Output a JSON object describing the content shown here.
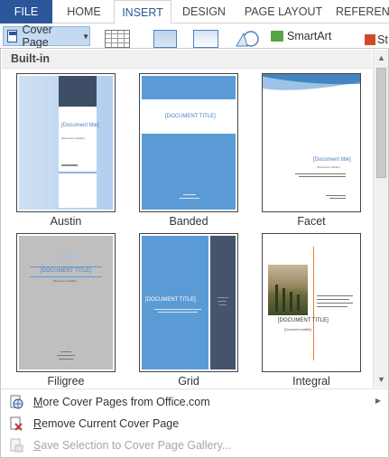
{
  "ribbon": {
    "tabs": [
      {
        "label": "FILE"
      },
      {
        "label": "HOME"
      },
      {
        "label": "INSERT"
      },
      {
        "label": "DESIGN"
      },
      {
        "label": "PAGE LAYOUT"
      },
      {
        "label": "REFERENC"
      }
    ],
    "active_tab": "INSERT",
    "cover_page_button": "Cover Page",
    "smartart_label": "SmartArt",
    "store_label": "St"
  },
  "gallery": {
    "section_label": "Built-in",
    "templates": [
      {
        "name": "Austin",
        "title": "[Document title]",
        "subtitle": "[Document subtitle]"
      },
      {
        "name": "Banded",
        "title": "[DOCUMENT TITLE]"
      },
      {
        "name": "Facet",
        "title": "[Document title]",
        "subtitle": "[Document subtitle]"
      },
      {
        "name": "Filigree",
        "title": "[DOCUMENT TITLE]",
        "subtitle": "[Document subtitle]"
      },
      {
        "name": "Grid",
        "title": "[DOCUMENT TITLE]"
      },
      {
        "name": "Integral",
        "title": "[DOCUMENT TITLE]",
        "subtitle": "[Document subtitle]"
      }
    ]
  },
  "menu": {
    "more_from_office": {
      "pre": "",
      "ul": "M",
      "post": "ore Cover Pages from Office.com"
    },
    "remove_current": {
      "pre": "",
      "ul": "R",
      "post": "emove Current Cover Page"
    },
    "save_selection": {
      "pre": "",
      "ul": "S",
      "post": "ave Selection to Cover Page Gallery..."
    }
  },
  "colors": {
    "file_tab": "#2b579a",
    "accent_blue": "#5b9bd5",
    "dark_slate": "#44546a",
    "selected_button": "#c5d9f1"
  }
}
